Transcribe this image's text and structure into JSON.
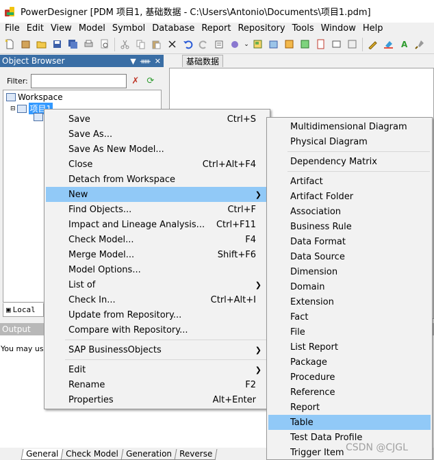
{
  "window": {
    "title": "PowerDesigner [PDM 项目1, 基础数据 - C:\\Users\\Antonio\\Documents\\项目1.pdm]"
  },
  "menubar": [
    "File",
    "Edit",
    "View",
    "Model",
    "Symbol",
    "Database",
    "Report",
    "Repository",
    "Tools",
    "Window",
    "Help"
  ],
  "object_browser": {
    "title": "Object Browser",
    "filter_label": "Filter:",
    "filter_value": "",
    "tree": {
      "workspace": "Workspace",
      "model": "项目1"
    },
    "local_tab": "Local"
  },
  "diagram": {
    "tab": "基础数据"
  },
  "output": {
    "title": "Output",
    "text": "You may use t"
  },
  "bottom_tabs": [
    "General",
    "Check Model",
    "Generation",
    "Reverse"
  ],
  "context_menu": [
    {
      "label": "Save",
      "shortcut": "Ctrl+S"
    },
    {
      "label": "Save As...",
      "shortcut": ""
    },
    {
      "label": "Save As New Model...",
      "shortcut": ""
    },
    {
      "label": "Close",
      "shortcut": "Ctrl+Alt+F4"
    },
    {
      "label": "Detach from Workspace",
      "shortcut": ""
    },
    {
      "label": "New",
      "shortcut": "",
      "submenu": true
    },
    {
      "label": "Find Objects...",
      "shortcut": "Ctrl+F"
    },
    {
      "label": "Impact and Lineage Analysis...",
      "shortcut": "Ctrl+F11"
    },
    {
      "label": "Check Model...",
      "shortcut": "F4"
    },
    {
      "label": "Merge Model...",
      "shortcut": "Shift+F6"
    },
    {
      "label": "Model Options...",
      "shortcut": ""
    },
    {
      "label": "List of",
      "shortcut": "",
      "submenu": true
    },
    {
      "label": "Check In...",
      "shortcut": "Ctrl+Alt+I"
    },
    {
      "label": "Update from Repository...",
      "shortcut": ""
    },
    {
      "label": "Compare with Repository...",
      "shortcut": ""
    },
    {
      "label": "SAP BusinessObjects",
      "shortcut": "",
      "submenu": true
    },
    {
      "label": "Edit",
      "shortcut": "",
      "submenu": true
    },
    {
      "label": "Rename",
      "shortcut": "F2"
    },
    {
      "label": "Properties",
      "shortcut": "Alt+Enter"
    }
  ],
  "new_submenu": [
    "Multidimensional Diagram",
    "Physical Diagram",
    "Dependency Matrix",
    "Artifact",
    "Artifact Folder",
    "Association",
    "Business Rule",
    "Data Format",
    "Data Source",
    "Dimension",
    "Domain",
    "Extension",
    "Fact",
    "File",
    "List Report",
    "Package",
    "Procedure",
    "Reference",
    "Report",
    "Table",
    "Test Data Profile",
    "Trigger Item"
  ],
  "watermark": "CSDN @CJGL",
  "colors": {
    "highlight": "#91c9f7",
    "panel_header": "#3a6ea5"
  }
}
